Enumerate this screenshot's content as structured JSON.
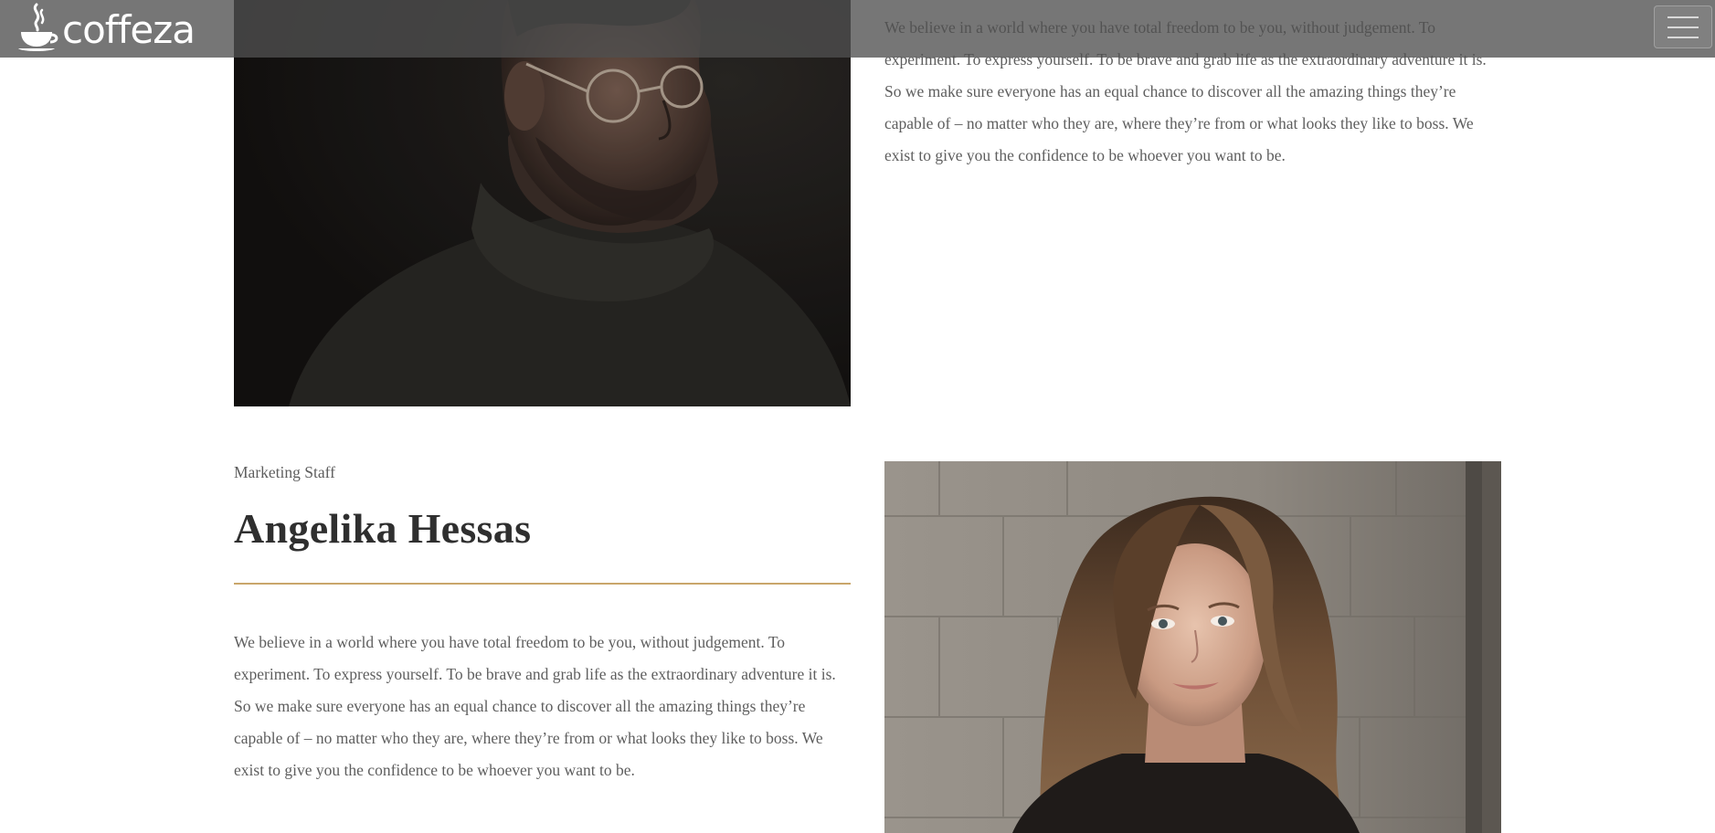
{
  "header": {
    "logo_text": "coffeza",
    "logo_icon": "coffee-cup-icon",
    "menu_icon": "hamburger-menu-icon"
  },
  "profiles": [
    {
      "bio": "We believe in a world where you have total freedom to be you, without judgement. To experiment. To express yourself. To be brave and grab life as the extraordinary adventure it is. So we make sure everyone has an equal chance to discover all the amazing things they’re capable of – no matter who they are, where they’re from or what looks they like to boss. We exist to give you the confidence to be whoever you want to be."
    },
    {
      "role": "Marketing Staff",
      "name": "Angelika Hessas",
      "bio": "We believe in a world where you have total freedom to be you, without judgement. To experiment. To express yourself. To be brave and grab life as the extraordinary adventure it is. So we make sure everyone has an equal chance to discover all the amazing things they’re capable of – no matter who they are, where they’re from or what looks they like to boss. We exist to give you the confidence to be whoever you want to be."
    }
  ],
  "colors": {
    "accent_rule": "#c9a66b",
    "header_overlay": "#505050",
    "body_text": "#5e5e5e",
    "heading_text": "#2f2f2f"
  }
}
